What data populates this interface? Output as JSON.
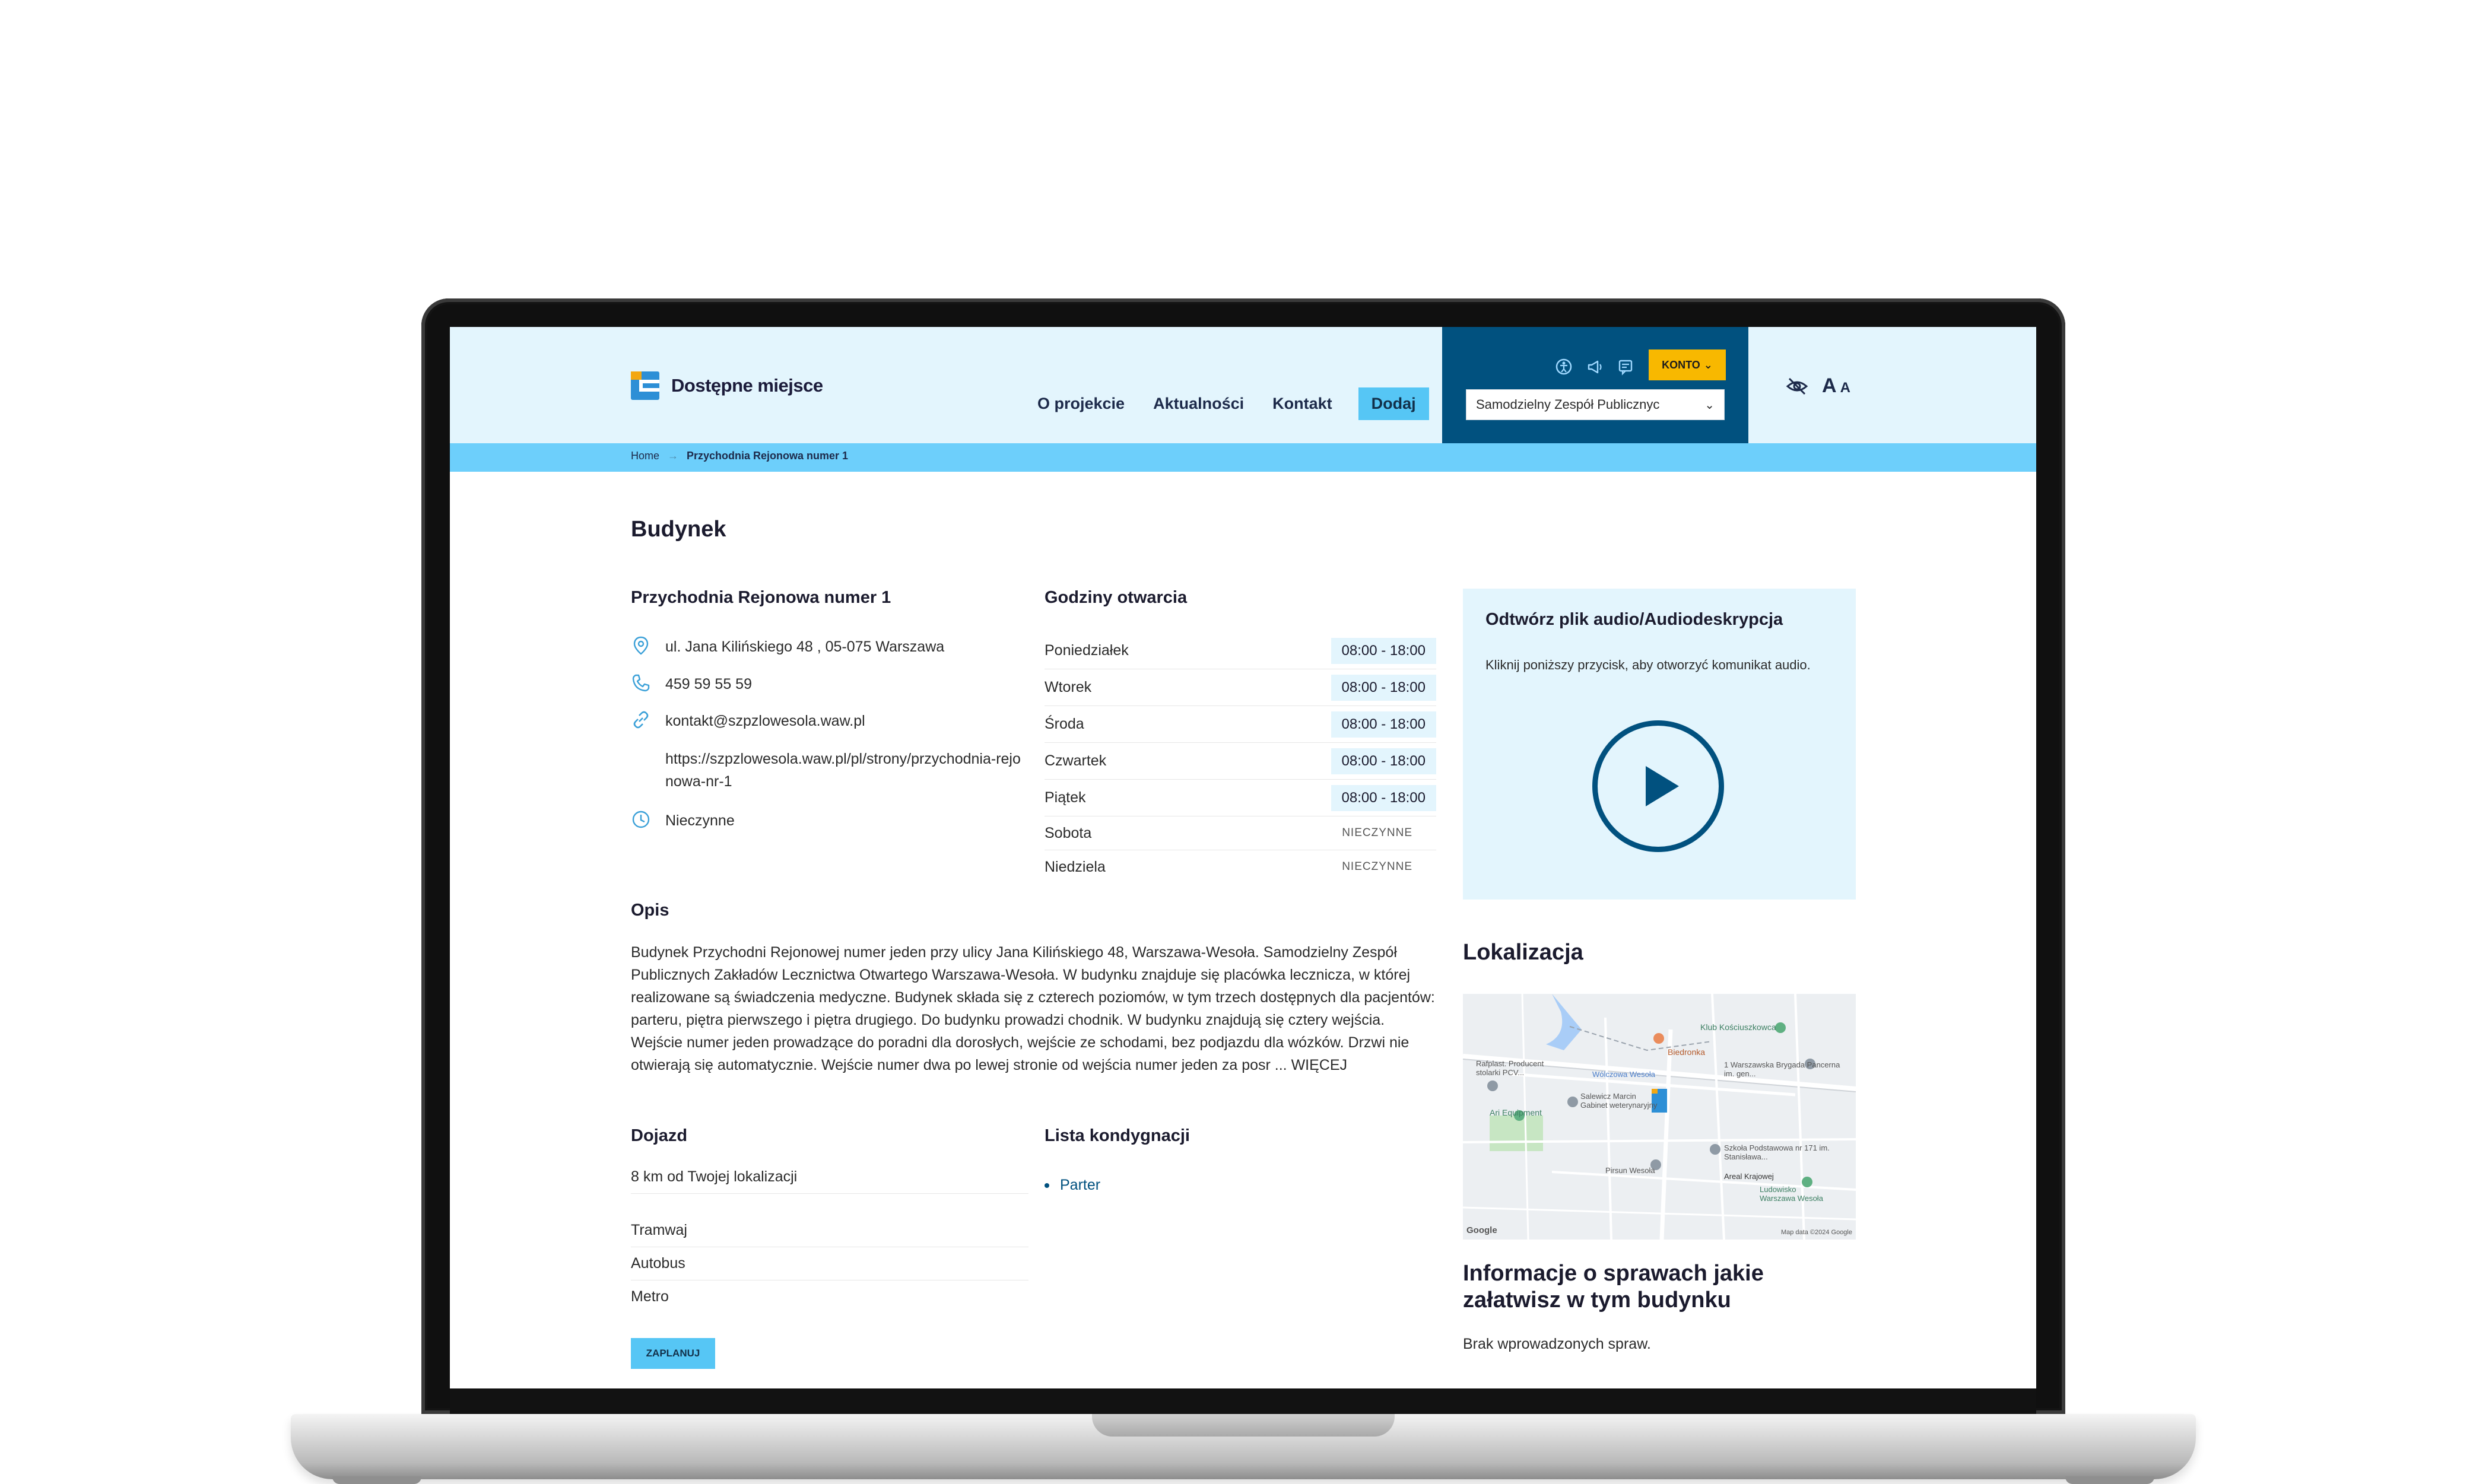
{
  "header": {
    "logo_text": "Dostępne miejsce",
    "nav": [
      {
        "label": "O projekcie"
      },
      {
        "label": "Aktualności"
      },
      {
        "label": "Kontakt"
      },
      {
        "label": "Dodaj"
      }
    ],
    "account_label": "KONTO",
    "organization_select": "Samodzielny Zespół Publicznyc",
    "font_size_large": "A",
    "font_size_small": "A",
    "icons": [
      "accessibility-icon",
      "megaphone-icon",
      "sign-language-icon",
      "eye-off-icon"
    ]
  },
  "breadcrumb": {
    "home": "Home",
    "separator": "→",
    "current": "Przychodnia Rejonowa numer 1"
  },
  "page": {
    "title": "Budynek"
  },
  "facility": {
    "name": "Przychodnia Rejonowa numer 1",
    "address": "ul. Jana Kilińskiego 48 , 05-075 Warszawa",
    "phone": "459 59 55 59",
    "email": "kontakt@szpzlowesola.waw.pl",
    "website": "https://szpzlowesola.waw.pl/pl/strony/przychodnia-rejonowa-nr-1",
    "status": "Nieczynne"
  },
  "hours": {
    "title": "Godziny otwarcia",
    "days": [
      {
        "day": "Poniedziałek",
        "time": "08:00 - 18:00",
        "open": true
      },
      {
        "day": "Wtorek",
        "time": "08:00 - 18:00",
        "open": true
      },
      {
        "day": "Środa",
        "time": "08:00 - 18:00",
        "open": true
      },
      {
        "day": "Czwartek",
        "time": "08:00 - 18:00",
        "open": true
      },
      {
        "day": "Piątek",
        "time": "08:00 - 18:00",
        "open": true
      },
      {
        "day": "Sobota",
        "time": "NIECZYNNE",
        "open": false
      },
      {
        "day": "Niedziela",
        "time": "NIECZYNNE",
        "open": false
      }
    ]
  },
  "audio": {
    "title": "Odtwórz plik audio/Audiodeskrypcja",
    "description": "Kliknij poniższy przycisk, aby otworzyć komunikat audio."
  },
  "description": {
    "title": "Opis",
    "text": "Budynek Przychodni Rejonowej numer jeden przy ulicy Jana Kilińskiego 48, Warszawa-Wesoła. Samodzielny Zespół Publicznych Zakładów Lecznictwa Otwartego Warszawa-Wesoła. W budynku znajduje się placówka lecznicza, w której realizowane są świadczenia medyczne. Budynek składa się z czterech poziomów, w tym trzech dostępnych dla pacjentów: parteru, piętra pierwszego i piętra drugiego. Do budynku prowadzi chodnik. W budynku znajdują się cztery wejścia. Wejście numer jeden prowadzące do poradni dla dorosłych, wejście ze schodami, bez podjazdu dla wózków. Drzwi nie otwierają się automatycznie. Wejście numer dwa po lewej stronie od wejścia numer jeden za posr ...",
    "more_label": "WIĘCEJ"
  },
  "transport": {
    "title": "Dojazd",
    "distance": "8 km od Twojej lokalizacji",
    "modes": [
      "Tramwaj",
      "Autobus",
      "Metro"
    ],
    "plan_button": "ZAPLANUJ"
  },
  "floors": {
    "title": "Lista kondygnacji",
    "items": [
      "Parter"
    ]
  },
  "location": {
    "title": "Lokalizacja",
    "map_labels": {
      "club": "Klub Kościuszkowca",
      "biedronka": "Biedronka",
      "street_brigade": "1 Warszawska Brygada Pancerna im. gen...",
      "rafplast": "Rafplast. Producent stolarki PCV...",
      "wesola": "Wólczowa Wesoła",
      "salewicz": "Salewicz Marcin Gabinet weterynaryjny",
      "ari": "Ari Equipment",
      "school": "Szkoła Podstawowa nr 171 im. Stanisława...",
      "areal": "Areal Krajowej",
      "ludowisko": "Ludowisko Warszawa Wesoła",
      "pirsun": "Pirsun Wesoła",
      "google": "Google",
      "map_data": "Map data ©2024 Google"
    }
  },
  "cases": {
    "title": "Informacje o sprawach jakie załatwisz w tym budynku",
    "empty_text": "Brak wprowadzonych spraw."
  },
  "colors": {
    "header_bg": "#e3f5fd",
    "accent_dark": "#01517f",
    "accent_light": "#56c6f5",
    "konto_yellow": "#f8b800",
    "breadcrumb_bg": "#6dcffb"
  }
}
